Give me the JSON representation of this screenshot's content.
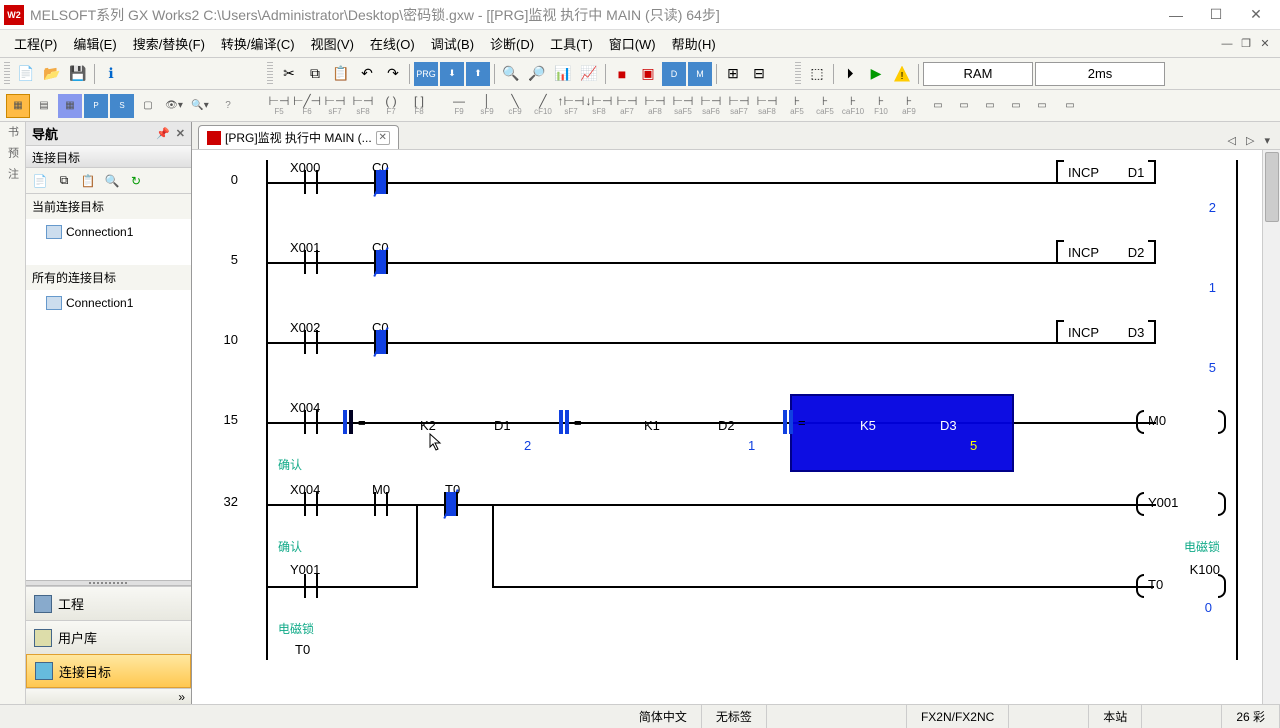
{
  "title": "MELSOFT系列 GX Works2 C:\\Users\\Administrator\\Desktop\\密码锁.gxw - [[PRG]监视 执行中 MAIN (只读) 64步]",
  "menu": {
    "project": "工程(P)",
    "edit": "编辑(E)",
    "search": "搜索/替换(F)",
    "convert": "转换/编译(C)",
    "view": "视图(V)",
    "online": "在线(O)",
    "debug": "调试(B)",
    "diagnose": "诊断(D)",
    "tools": "工具(T)",
    "window": "窗口(W)",
    "help": "帮助(H)"
  },
  "toolbar": {
    "status_ram": "RAM",
    "status_time": "2ms"
  },
  "nav": {
    "title": "导航",
    "sub": "连接目标",
    "section1": "当前连接目标",
    "conn1": "Connection1",
    "section2": "所有的连接目标",
    "conn2": "Connection1",
    "btn_project": "工程",
    "btn_userlib": "用户库",
    "btn_target": "连接目标"
  },
  "tab": {
    "label": "[PRG]监视 执行中 MAIN (..."
  },
  "ladder": {
    "r0": {
      "step": "0",
      "x": "X000",
      "c": "C0",
      "instr": "INCP",
      "d": "D1",
      "v": "2"
    },
    "r1": {
      "step": "5",
      "x": "X001",
      "c": "C0",
      "instr": "INCP",
      "d": "D2",
      "v": "1"
    },
    "r2": {
      "step": "10",
      "x": "X002",
      "c": "C0",
      "instr": "INCP",
      "d": "D3",
      "v": "5"
    },
    "r3": {
      "step": "15",
      "x": "X004",
      "cmt": "确认",
      "k1": "K2",
      "d1": "D1",
      "v1": "2",
      "k2": "K1",
      "d2": "D2",
      "v2": "1",
      "k3": "K5",
      "d3": "D3",
      "v3": "5",
      "out": "M0",
      "eq": "="
    },
    "r4": {
      "step": "32",
      "x": "X004",
      "m": "M0",
      "t": "T0",
      "cmt": "确认",
      "y": "Y001",
      "ycmt": "电磁锁",
      "yk": "K100",
      "y2": "Y001",
      "to": "T0",
      "tov": "0"
    },
    "r5": {
      "cmt": "电磁锁",
      "t": "T0"
    }
  },
  "status": {
    "lang": "简体中文",
    "label": "无标签",
    "plc": "FX2N/FX2NC",
    "station": "本站",
    "step": "26 彩"
  },
  "leftstrip": {
    "bookmark": "书",
    "preview": "预",
    "notes": "注"
  }
}
